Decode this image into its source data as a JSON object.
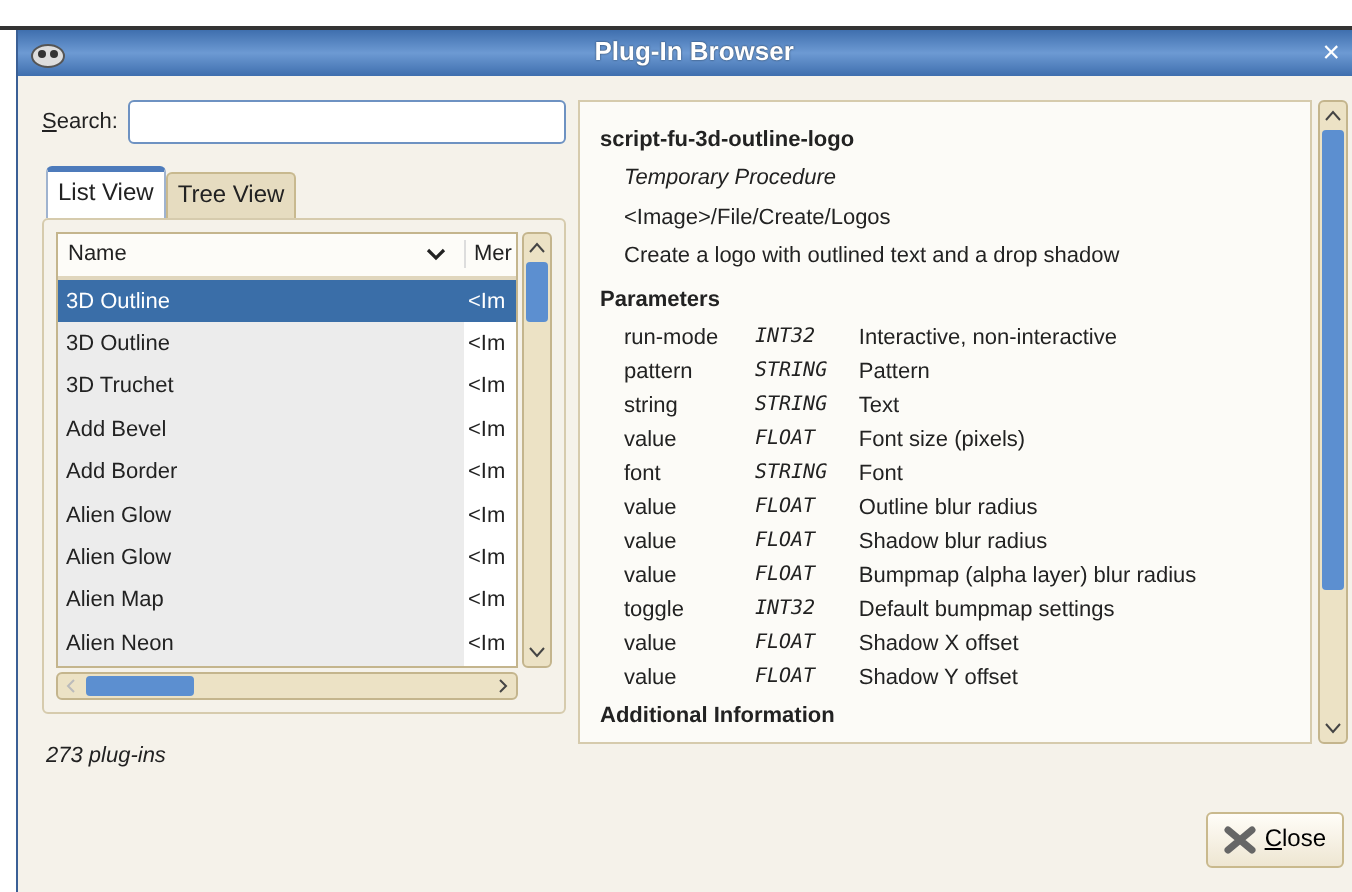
{
  "window": {
    "title": "Plug-In Browser",
    "close": "×"
  },
  "search": {
    "label": "Search:"
  },
  "tabs": [
    {
      "label": "List View",
      "selected": true
    },
    {
      "label": "Tree View",
      "selected": false
    }
  ],
  "list": {
    "columns": [
      "Name",
      "Mer"
    ],
    "rows": [
      {
        "name": "3D Outline",
        "menu": "<Im",
        "selected": true
      },
      {
        "name": "3D Outline",
        "menu": "<Im",
        "selected": false
      },
      {
        "name": "3D Truchet",
        "menu": "<Im",
        "selected": false
      },
      {
        "name": "Add Bevel",
        "menu": "<Im",
        "selected": false
      },
      {
        "name": "Add Border",
        "menu": "<Im",
        "selected": false
      },
      {
        "name": "Alien Glow",
        "menu": "<Im",
        "selected": false
      },
      {
        "name": "Alien Glow",
        "menu": "<Im",
        "selected": false
      },
      {
        "name": "Alien Map",
        "menu": "<Im",
        "selected": false
      },
      {
        "name": "Alien Neon",
        "menu": "<Im",
        "selected": false
      }
    ]
  },
  "count": "273 plug-ins",
  "details": {
    "name": "script-fu-3d-outline-logo",
    "type": "Temporary Procedure",
    "menu_path": "<Image>/File/Create/Logos",
    "description": "Create a logo with outlined text and a drop shadow",
    "parameters_heading": "Parameters",
    "parameters": [
      {
        "name": "run-mode",
        "type": "INT32",
        "description": "Interactive, non-interactive"
      },
      {
        "name": "pattern",
        "type": "STRING",
        "description": "Pattern"
      },
      {
        "name": "string",
        "type": "STRING",
        "description": "Text"
      },
      {
        "name": "value",
        "type": "FLOAT",
        "description": "Font size (pixels)"
      },
      {
        "name": "font",
        "type": "STRING",
        "description": "Font"
      },
      {
        "name": "value",
        "type": "FLOAT",
        "description": "Outline blur radius"
      },
      {
        "name": "value",
        "type": "FLOAT",
        "description": "Shadow blur radius"
      },
      {
        "name": "value",
        "type": "FLOAT",
        "description": "Bumpmap (alpha layer) blur radius"
      },
      {
        "name": "toggle",
        "type": "INT32",
        "description": "Default bumpmap settings"
      },
      {
        "name": "value",
        "type": "FLOAT",
        "description": "Shadow X offset"
      },
      {
        "name": "value",
        "type": "FLOAT",
        "description": "Shadow Y offset"
      }
    ],
    "next_heading": "Additional Information"
  },
  "buttons": [
    {
      "label": "Close"
    }
  ]
}
